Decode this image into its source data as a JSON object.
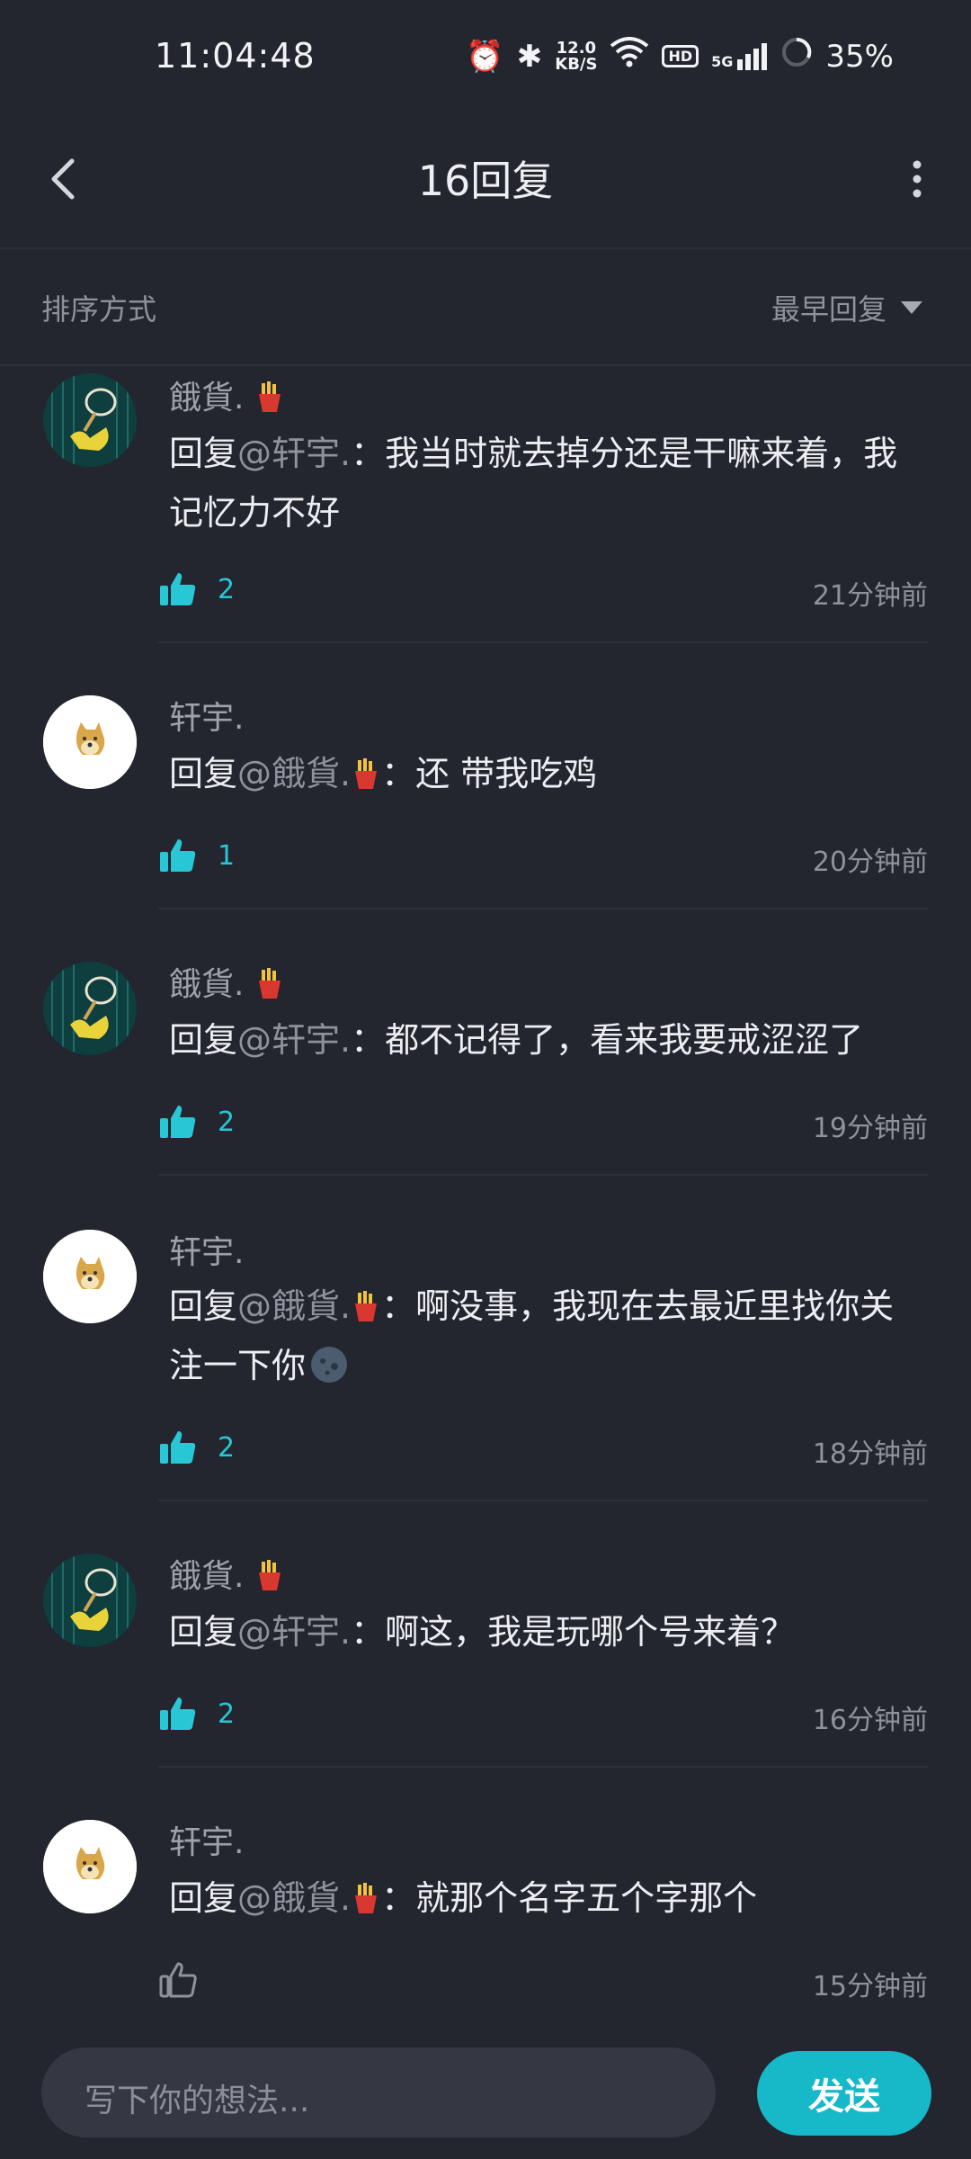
{
  "status_bar": {
    "time": "11:04:48",
    "net_speed_value": "12.0",
    "net_speed_unit": "KB/S",
    "hd_label": "HD",
    "signal_label": "5G",
    "battery": "35%"
  },
  "header": {
    "title": "16回复",
    "back_icon": "chevron-left-icon",
    "more_icon": "vertical-dots-icon"
  },
  "sort": {
    "label": "排序方式",
    "value": "最早回复"
  },
  "replies": [
    {
      "name": "餓貨.",
      "avatar": "net-avatar",
      "text_prefix": "回复",
      "mention": "@轩宇.",
      "text": "：我当时就去掉分还是干嘛来着，我记忆力不好",
      "likes": "2",
      "time": "21分钟前"
    },
    {
      "name": "轩宇.",
      "avatar": "doge-avatar",
      "text_prefix": "回复",
      "mention": "@餓貨.",
      "text": "：还 带我吃鸡",
      "likes": "1",
      "time": "20分钟前"
    },
    {
      "name": "餓貨.",
      "avatar": "net-avatar",
      "text_prefix": "回复",
      "mention": "@轩宇.",
      "text": "：都不记得了，看来我要戒涩涩了",
      "likes": "2",
      "time": "19分钟前"
    },
    {
      "name": "轩宇.",
      "avatar": "doge-avatar",
      "text_prefix": "回复",
      "mention": "@餓貨.",
      "text": "：啊没事，我现在去最近里找你关注一下你",
      "likes": "2",
      "time": "18分钟前"
    },
    {
      "name": "餓貨.",
      "avatar": "net-avatar",
      "text_prefix": "回复",
      "mention": "@轩宇.",
      "text": "：啊这，我是玩哪个号来着？",
      "likes": "2",
      "time": "16分钟前"
    },
    {
      "name": "轩宇.",
      "avatar": "doge-avatar",
      "text_prefix": "回复",
      "mention": "@餓貨.",
      "text": "：就那个名字五个字那个",
      "likes": "",
      "time": "15分钟前"
    }
  ],
  "composer": {
    "placeholder": "写下你的想法...",
    "send_label": "发送"
  },
  "colors": {
    "background": "#23252f",
    "accent": "#17b8c8",
    "like_blue": "#27c7d6"
  }
}
